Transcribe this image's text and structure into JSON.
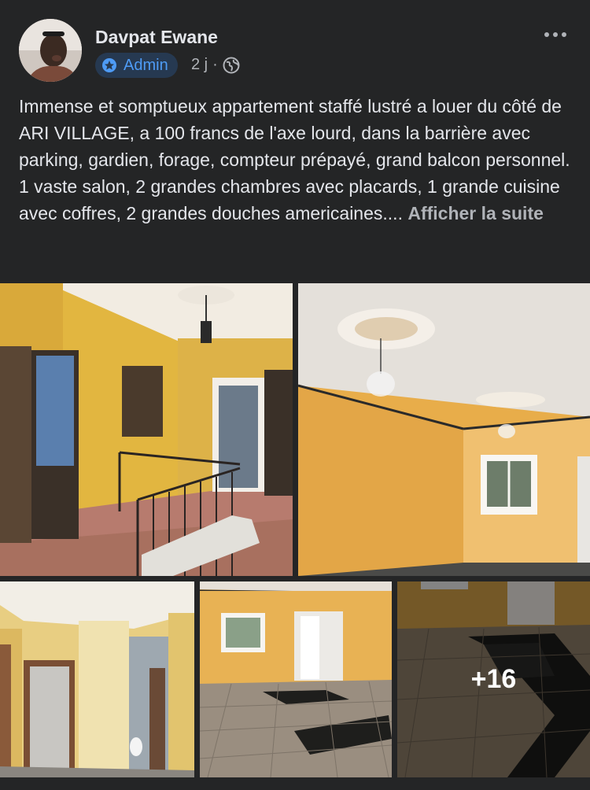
{
  "post": {
    "author": "Davpat Ewane",
    "role_badge": "Admin",
    "time": "2 j",
    "separator": "·",
    "audience_icon": "globe-icon",
    "more_icon": "more-options-icon",
    "body": "Immense et somptueux appartement staffé lustré a louer du côté de ARI VILLAGE, a 100 francs de l'axe lourd, dans la barrière avec parking, gardien, forage, compteur prépayé, grand balcon personnel.\n1 vaste salon, 2 grandes chambres avec placards, 1 grande cuisine avec coffres, 2 grandes douches americaines.... ",
    "see_more": "Afficher la suite"
  },
  "photos": {
    "remaining_count": "+16"
  },
  "colors": {
    "background": "#242526",
    "badge_background": "#263951",
    "badge_text": "#4e9bf5",
    "secondary_text": "#b0b3b8"
  }
}
